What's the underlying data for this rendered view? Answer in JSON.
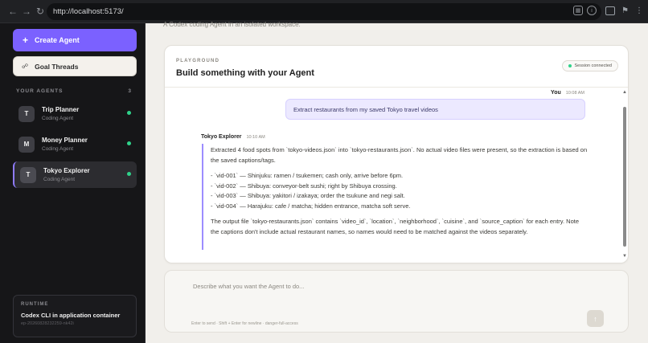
{
  "browser": {
    "url": "http://localhost:5173/"
  },
  "sidebar": {
    "create_label": "Create Agent",
    "goal_label": "Goal Threads",
    "agents_heading": "YOUR AGENTS",
    "agents_count": "3",
    "agents": [
      {
        "initial": "T",
        "name": "Trip Planner",
        "type": "Coding Agent",
        "active": false
      },
      {
        "initial": "M",
        "name": "Money Planner",
        "type": "Coding Agent",
        "active": false
      },
      {
        "initial": "T",
        "name": "Tokyo Explorer",
        "type": "Coding Agent",
        "active": true
      }
    ],
    "runtime": {
      "label": "RUNTIME",
      "value": "Codex CLI in application container",
      "id": "ep-20260828232259-nk42i"
    }
  },
  "main": {
    "description": "A Codex coding Agent in an isolated workspace.",
    "eyebrow": "PLAYGROUND",
    "title": "Build something with your Agent",
    "session_status": "Session connected",
    "user_message": {
      "author": "You",
      "time": "10:08 AM",
      "text": "Extract restaurants from my saved Tokyo travel videos"
    },
    "agent_message": {
      "author": "Tokyo Explorer",
      "time": "10:10 AM",
      "intro": "Extracted 4 food spots from `tokyo-videos.json` into `tokyo-restaurants.json`. No actual video files were present, so the extraction is based on the saved captions/tags.",
      "items": [
        "- `vid-001` — Shinjuku: ramen / tsukemen; cash only, arrive before 6pm.",
        "- `vid-002` — Shibuya: conveyor-belt sushi; right by Shibuya crossing.",
        "- `vid-003` — Shibuya: yakitori / izakaya; order the tsukune and negi salt.",
        "- `vid-004` — Harajuku: cafe / matcha; hidden entrance, matcha soft serve."
      ],
      "outro": "The output file `tokyo-restaurants.json` contains `video_id`, `location`, `neighborhood`, `cuisine`, and `source_caption` for each entry. Note the captions don't include actual restaurant names, so names would need to be matched against the videos separately."
    },
    "composer": {
      "placeholder": "Describe what you want the Agent to do...",
      "hint": "Enter to send · Shift + Enter for newline · danger-full-access"
    }
  }
}
